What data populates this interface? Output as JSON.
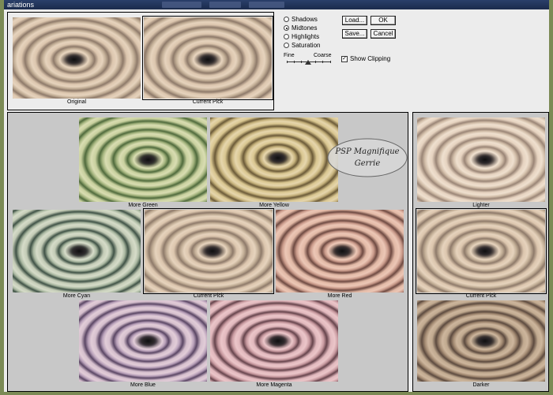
{
  "window": {
    "title": "ariations"
  },
  "top_thumbs": {
    "original": "Original",
    "current": "Current Pick"
  },
  "tone": {
    "options": [
      "Shadows",
      "Midtones",
      "Highlights",
      "Saturation"
    ],
    "selected": "Midtones"
  },
  "buttons": {
    "load": "Load...",
    "ok": "OK",
    "save": "Save...",
    "cancel": "Cancel"
  },
  "slider": {
    "fine": "Fine",
    "coarse": "Coarse"
  },
  "show_clipping": {
    "label": "Show Clipping",
    "checked": true
  },
  "grid": {
    "more_green": "More Green",
    "more_yellow": "More Yellow",
    "more_cyan": "More Cyan",
    "current": "Current Pick",
    "more_red": "More Red",
    "more_blue": "More Blue",
    "more_magenta": "More Magenta"
  },
  "brightness": {
    "lighter": "Lighter",
    "current": "Current Pick",
    "darker": "Darker"
  },
  "watermark": {
    "line1": "PSP Magnifique",
    "line2": "Gerrie"
  },
  "colors": {
    "desktop": "#7b8a55",
    "dialog": "#ececec",
    "panel": "#c8c8c8"
  }
}
